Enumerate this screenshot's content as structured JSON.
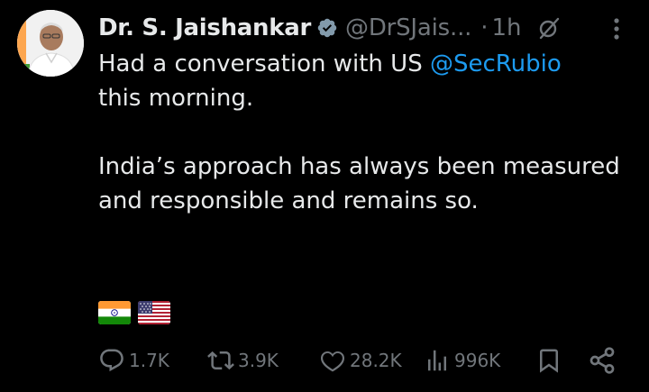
{
  "author": {
    "display_name": "Dr. S. Jaishankar",
    "handle": "@DrSJais...",
    "time_separator": "·",
    "time": "1h",
    "verified": true,
    "avatar_icon": "profile-photo"
  },
  "tweet": {
    "line1_text": "Had a conversation with US ",
    "line1_mention": "@SecRubio",
    "line2_text": "this morning.",
    "paragraph2": "India’s approach has always been measured and responsible and remains so.",
    "emojis": [
      "india-flag",
      "us-flag"
    ]
  },
  "actions": {
    "replies": "1.7K",
    "reposts": "3.9K",
    "likes": "28.2K",
    "views": "996K"
  },
  "icons": {
    "verified": "verified-badge-icon",
    "grok": "grok-icon",
    "more": "more-vertical-icon",
    "reply": "reply-icon",
    "repost": "repost-icon",
    "like": "heart-icon",
    "views": "views-icon",
    "bookmark": "bookmark-icon",
    "share": "share-icon"
  },
  "colors": {
    "background": "#000000",
    "text": "#e7e9ea",
    "secondary": "#71767b",
    "mention": "#1d9bf0",
    "verified_badge": "#829aab"
  }
}
